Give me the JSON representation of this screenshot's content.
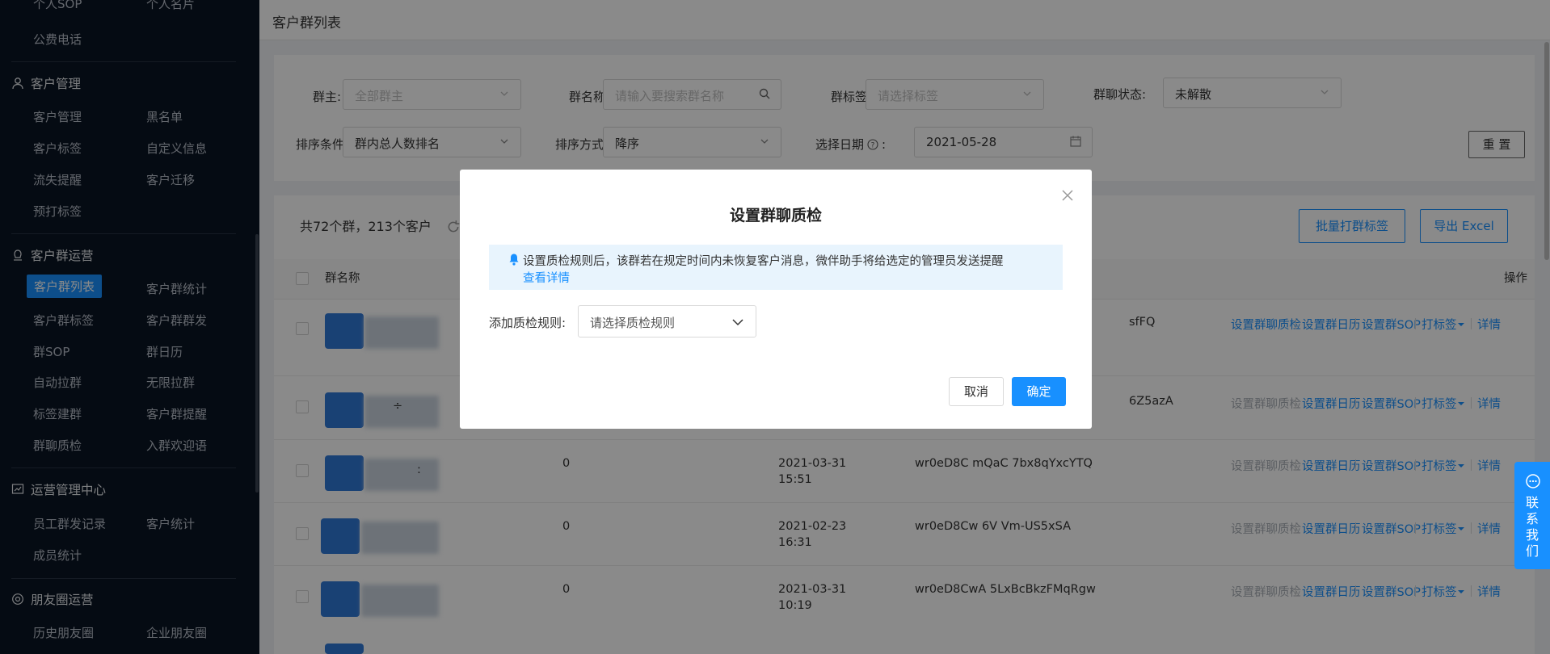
{
  "sidebar": {
    "top_items": [
      "个人SOP",
      "个人名片",
      "公费电话"
    ],
    "sections": [
      {
        "title": "客户管理",
        "icon": "user-icon",
        "items": [
          "客户管理",
          "黑名单",
          "客户标签",
          "自定义信息",
          "流失提醒",
          "客户迁移",
          "预打标签"
        ]
      },
      {
        "title": "客户群运营",
        "icon": "group-icon",
        "items": [
          "客户群列表",
          "客户群统计",
          "客户群标签",
          "客户群群发",
          "群SOP",
          "群日历",
          "自动拉群",
          "无限拉群",
          "标签建群",
          "客户群提醒",
          "群聊质检",
          "入群欢迎语"
        ]
      },
      {
        "title": "运营管理中心",
        "icon": "chart-icon",
        "items": [
          "员工群发记录",
          "客户统计",
          "成员统计"
        ]
      },
      {
        "title": "朋友圈运营",
        "icon": "moments-icon",
        "items": [
          "历史朋友圈",
          "企业朋友圈"
        ]
      }
    ]
  },
  "header": {
    "title": "客户群列表"
  },
  "filters": {
    "owner_label": "群主:",
    "owner_placeholder": "全部群主",
    "name_label": "群名称:",
    "name_placeholder": "请输入要搜索群名称",
    "tag_label": "群标签:",
    "tag_placeholder": "请选择标签",
    "status_label": "群聊状态:",
    "status_value": "未解散",
    "sort_label": "排序条件:",
    "sort_value": "群内总人数排名",
    "order_label": "排序方式:",
    "order_value": "降序",
    "date_label": "选择日期",
    "date_colon": ":",
    "date_value": "2021-05-28",
    "reset_label": "重 置"
  },
  "summary": {
    "text": "共72个群，213个客户"
  },
  "toolbar": {
    "batch_tag_label": "批量打群标签",
    "export_label": "导出 Excel"
  },
  "table": {
    "col_name": "群名称",
    "col_actions": "操作",
    "rows": [
      {
        "count": "",
        "time1": "",
        "time2": "",
        "chat_id": "sfFQ",
        "qc_enabled": true
      },
      {
        "count": "",
        "time1": "",
        "time2": "",
        "chat_id": "6Z5azA",
        "qc_enabled": false,
        "name_char": "÷"
      },
      {
        "count": "0",
        "time1": "2021-03-31",
        "time2": "15:51",
        "chat_id": "wr0eD8C      mQaC       7bx8qYxcYTQ",
        "qc_enabled": false,
        "name_char": ":"
      },
      {
        "count": "0",
        "time1": "2021-02-23",
        "time2": "16:31",
        "chat_id": "wr0eD8Cw        6V         Vm-US5xSA",
        "qc_enabled": false
      },
      {
        "count": "0",
        "time1": "2021-03-31",
        "time2": "10:19",
        "chat_id": "wr0eD8CwA              5LxBcBkzFMqRgw",
        "qc_enabled": false
      }
    ],
    "actions": {
      "qc": "设置群聊质检",
      "calendar": "设置群日历",
      "sop": "设置群SOP",
      "tag": "打标签",
      "detail": "详情"
    }
  },
  "modal": {
    "title": "设置群聊质检",
    "alert_text": "设置质检规则后，该群若在规定时间内未恢复客户消息，微伴助手将给选定的管理员发送提醒",
    "alert_link": "查看详情",
    "rule_label": "添加质检规则:",
    "rule_placeholder": "请选择质检规则",
    "cancel_label": "取消",
    "confirm_label": "确定"
  },
  "contact": {
    "label": "联系我们"
  },
  "colors": {
    "primary": "#1890ff",
    "sidebar_bg": "#0b1523"
  }
}
